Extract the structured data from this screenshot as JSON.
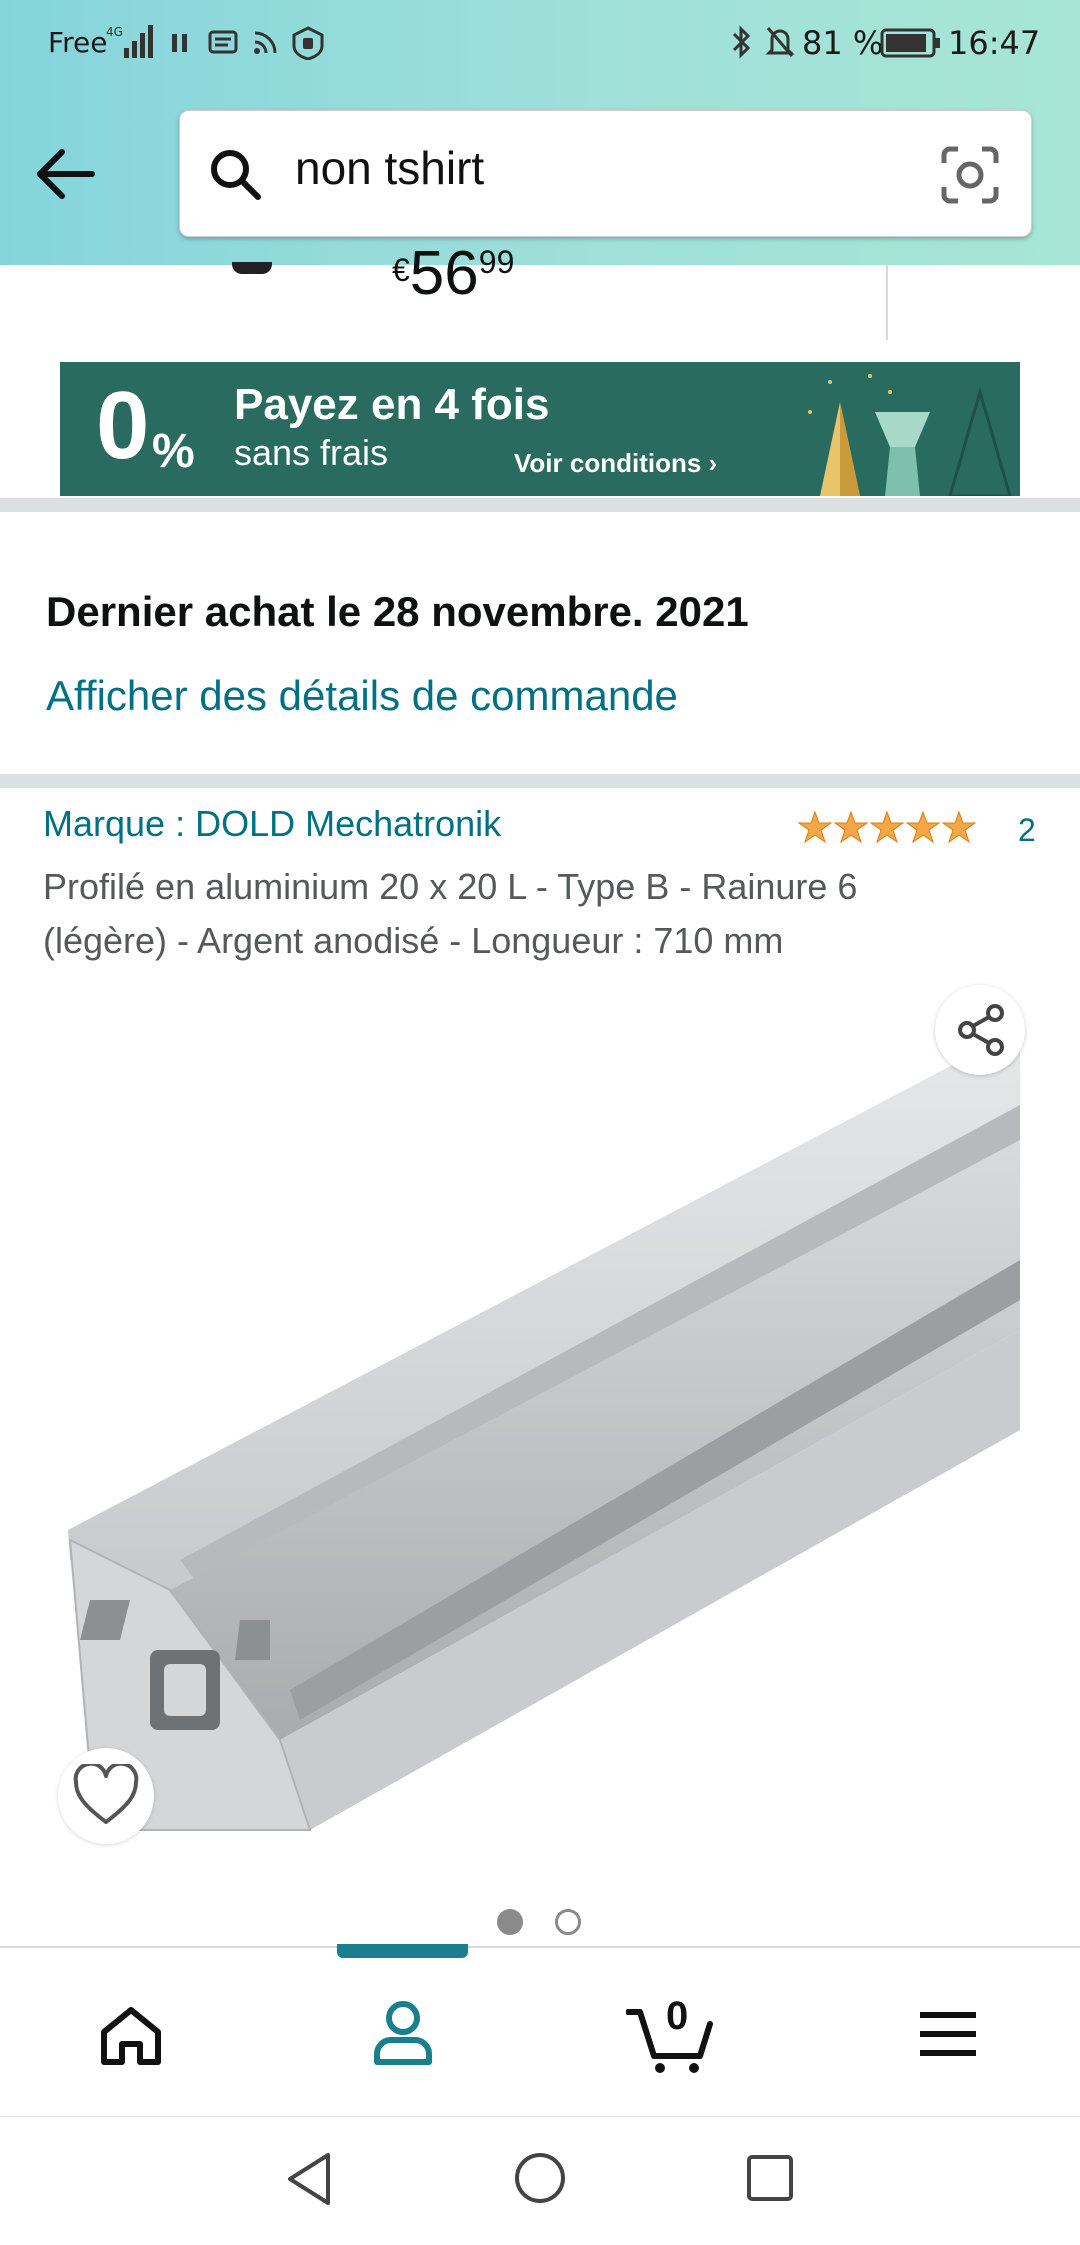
{
  "status_bar": {
    "carrier": "Free",
    "battery": "81 %",
    "time": "16:47"
  },
  "search": {
    "query": "non tshirt"
  },
  "product_top": {
    "currency": "€",
    "price_whole": "56",
    "price_fraction": "99"
  },
  "banner": {
    "percent": "0",
    "percent_sign": "%",
    "line1": "Payez en 4 fois",
    "line2": "sans frais",
    "cta": "Voir conditions ›"
  },
  "purchase": {
    "last_purchase": "Dernier achat le 28 novembre. 2021",
    "details_link": "Afficher des détails de commande"
  },
  "product": {
    "brand": "Marque : DOLD Mechatronik",
    "rating_stars": 5,
    "rating_count": "2",
    "title": "Profilé en aluminium 20 x 20 L - Type B - Rainure 6 (légère) - Argent anodisé - Longueur : 710 mm",
    "image_index": 1,
    "image_total": 2
  },
  "bottom_nav": {
    "cart_count": "0",
    "active_tab": "account"
  },
  "colors": {
    "accent_link": "#007185",
    "star": "#f3a847",
    "banner_bg": "#2a6b5f"
  }
}
